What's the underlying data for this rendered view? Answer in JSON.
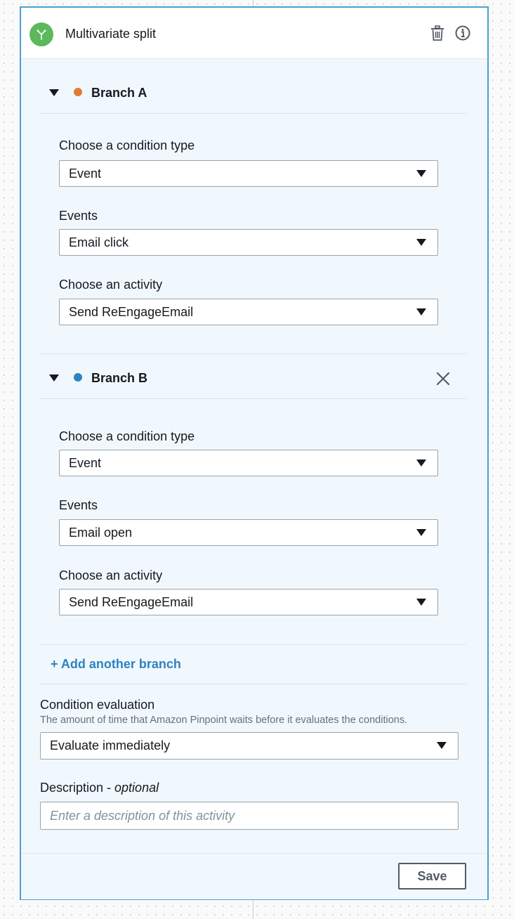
{
  "activity": {
    "title": "Multivariate split"
  },
  "branches": [
    {
      "name": "Branch A",
      "dot_color": "#e07b34",
      "condition_type_label": "Choose a condition type",
      "condition_type_value": "Event",
      "events_label": "Events",
      "events_value": "Email click",
      "activity_label": "Choose an activity",
      "activity_value": "Send ReEngageEmail"
    },
    {
      "name": "Branch B",
      "dot_color": "#2f82c0",
      "condition_type_label": "Choose a condition type",
      "condition_type_value": "Event",
      "events_label": "Events",
      "events_value": "Email open",
      "activity_label": "Choose an activity",
      "activity_value": "Send ReEngageEmail"
    }
  ],
  "add_branch_label": "+ Add another branch",
  "condition_evaluation": {
    "label": "Condition evaluation",
    "hint": "The amount of time that Amazon Pinpoint waits before it evaluates the conditions.",
    "value": "Evaluate immediately"
  },
  "description": {
    "label": "Description - ",
    "optional": "optional",
    "placeholder": "Enter a description of this activity"
  },
  "save_label": "Save",
  "icons": {
    "activity": "split-icon",
    "delete": "trash-icon",
    "info": "info-icon",
    "collapse": "caret-down-icon",
    "remove_branch": "close-icon",
    "dropdown": "chevron-down-icon"
  },
  "colors": {
    "accent": "#2f82c0",
    "panel_border": "#4a9fd0",
    "split_icon": "#5cb85c"
  }
}
